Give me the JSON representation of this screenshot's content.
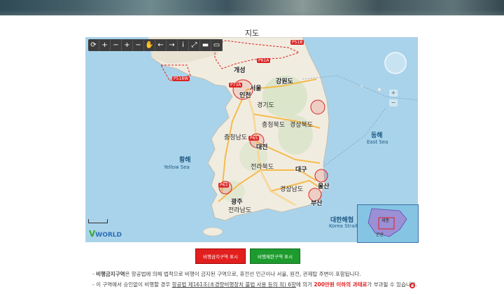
{
  "page": {
    "title": "지도"
  },
  "map": {
    "seas": {
      "yellow_ko": "황해",
      "yellow_en": "Yellow Sea",
      "east_ko": "동해",
      "east_en": "East Sea",
      "strait_ko": "대한해협",
      "strait_en": "Korea Strait"
    },
    "cities": {
      "kaesong": "개성",
      "seoul": "서울",
      "incheon": "인천",
      "gangwon": "강원도",
      "daejeon": "대전",
      "daegu": "대구",
      "ulsan": "울산",
      "busan": "부산",
      "gwangju": "광주",
      "jeolla": "전라북도",
      "gyeongbuk": "경상북도",
      "chungcheong": "충청북도",
      "jeonnam": "전라남도",
      "gyeongnam": "경상남도",
      "chungnam": "충청남도",
      "gyeonggi": "경기도"
    },
    "zones": {
      "p518": "P518",
      "p518w": "P518W",
      "p73a": "P73A",
      "p65": "P65",
      "p61a": "P61A",
      "p63": "P63"
    },
    "toolbar_icons": [
      "refresh-icon",
      "zoom-in-icon",
      "zoom-out-icon",
      "zoom-in-icon",
      "zoom-out-icon",
      "hand-icon",
      "back-icon",
      "forward-icon",
      "info-icon",
      "fullscreen-icon",
      "layer-icon",
      "layer2-icon"
    ],
    "toolbar_glyphs": [
      "⟳",
      "+",
      "−",
      "+",
      "−",
      "✋",
      "←",
      "→",
      "i",
      "⤢",
      "▬",
      "▭"
    ],
    "brand": "WORLD",
    "brand_v": "V",
    "minimap": {
      "label_a": "세종",
      "label_b": "군산"
    }
  },
  "buttons": {
    "prohibited": "비행금지구역 표시 On/Off",
    "restricted": "비행제한구역 표시 On/Off"
  },
  "notes": {
    "line1_a": "- ",
    "line1_hl": "비행금지구역",
    "line1_b": "은 항공법에 의해 법적으로 비행이 금지된 구역으로, 휴전선 인근이나 서울, 원전, 관제탑 주변이 포함됩니다.",
    "line2_a": "- 이 구역에서 승인없이 비행할 경우 ",
    "line2_link": "항공법 제161조(초경량비행장치 불법 사용 등의 죄) 6항",
    "line2_b": "에 의거 ",
    "line2_hl": "200만원 이하의 과태료",
    "line2_c": "가 부과될 수 있습니다."
  },
  "colors": {
    "prohibited_btn": "#e11f1f",
    "restricted_btn": "#1d9b2e",
    "sea": "#a9d3ea",
    "land": "#f1ece0",
    "road": "#f6b63d",
    "zone": "#d22"
  }
}
